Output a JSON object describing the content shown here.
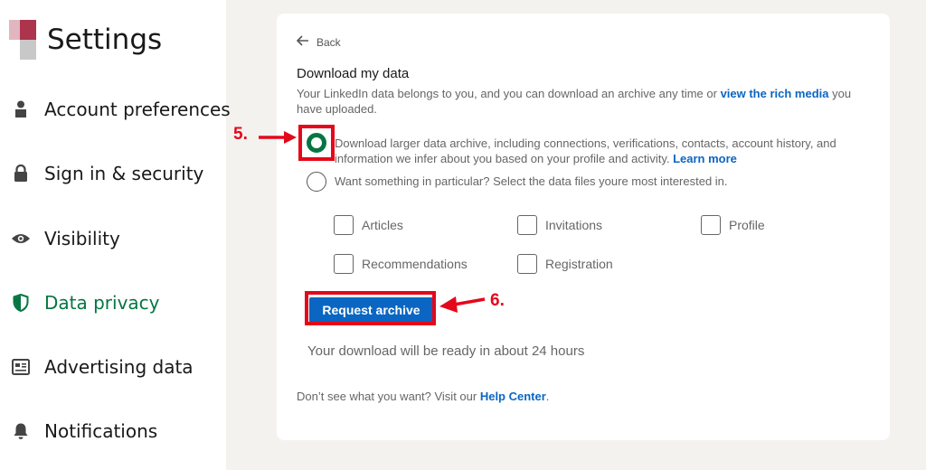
{
  "sidebar": {
    "title": "Settings",
    "items": [
      {
        "label": "Account preferences",
        "icon": "person-icon"
      },
      {
        "label": "Sign in & security",
        "icon": "lock-icon"
      },
      {
        "label": "Visibility",
        "icon": "eye-icon"
      },
      {
        "label": "Data privacy",
        "icon": "shield-icon",
        "active": true
      },
      {
        "label": "Advertising data",
        "icon": "newspaper-icon"
      },
      {
        "label": "Notifications",
        "icon": "bell-icon"
      }
    ]
  },
  "card": {
    "back_label": "Back",
    "heading": "Download my data",
    "description_pre": "Your LinkedIn data belongs to you, and you can download an archive any time or ",
    "description_link": "view the rich media",
    "description_post": " you have uploaded.",
    "option1_text": "Download larger data archive, including connections, verifications, contacts, account history, and information we infer about you based on your profile and activity. ",
    "option1_link": "Learn more",
    "option2_text": "Want something in particular? Select the data files youre most interested in.",
    "checkboxes": [
      "Articles",
      "Invitations",
      "Profile",
      "Recommendations",
      "Registration"
    ],
    "request_button": "Request archive",
    "ready_text": "Your download will be ready in about 24 hours",
    "help_pre": "Don’t see what you want? Visit our ",
    "help_link": "Help Center",
    "help_post": "."
  },
  "annotations": {
    "step5": "5.",
    "step6": "6."
  },
  "colors": {
    "accent_green": "#057642",
    "link_blue": "#0a66c2",
    "callout_red": "#e4081a"
  }
}
